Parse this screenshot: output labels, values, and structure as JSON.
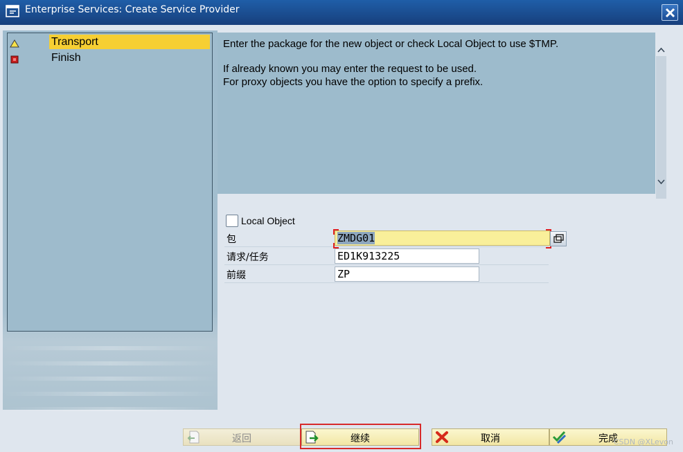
{
  "window": {
    "title": "Enterprise Services: Create Service Provider"
  },
  "steps": [
    {
      "label": "Transport",
      "status": "current",
      "icon": "warning-triangle-icon"
    },
    {
      "label": "Finish",
      "status": "pending",
      "icon": "red-square-icon"
    }
  ],
  "help": {
    "line1": "Enter the package for the new object or check Local Object to use $TMP.",
    "line2": "If already known you may enter the request to be used.",
    "line3": "For proxy objects you have the option to specify a prefix."
  },
  "form": {
    "local_object_label": "Local Object",
    "local_object_checked": false,
    "package_label": "包",
    "package_value": "ZMDG01",
    "request_label": "请求/任务",
    "request_value": "ED1K913225",
    "prefix_label": "前缀",
    "prefix_value": "ZP"
  },
  "buttons": {
    "back_label": "返回",
    "continue_label": "继续",
    "cancel_label": "取消",
    "complete_label": "完成"
  },
  "watermark": "CSDN @XLevon",
  "colors": {
    "titlebar": "#1f5ea8",
    "active_step": "#f6cf33",
    "panel": "#9dbbcc",
    "highlight": "#d72a2a"
  }
}
